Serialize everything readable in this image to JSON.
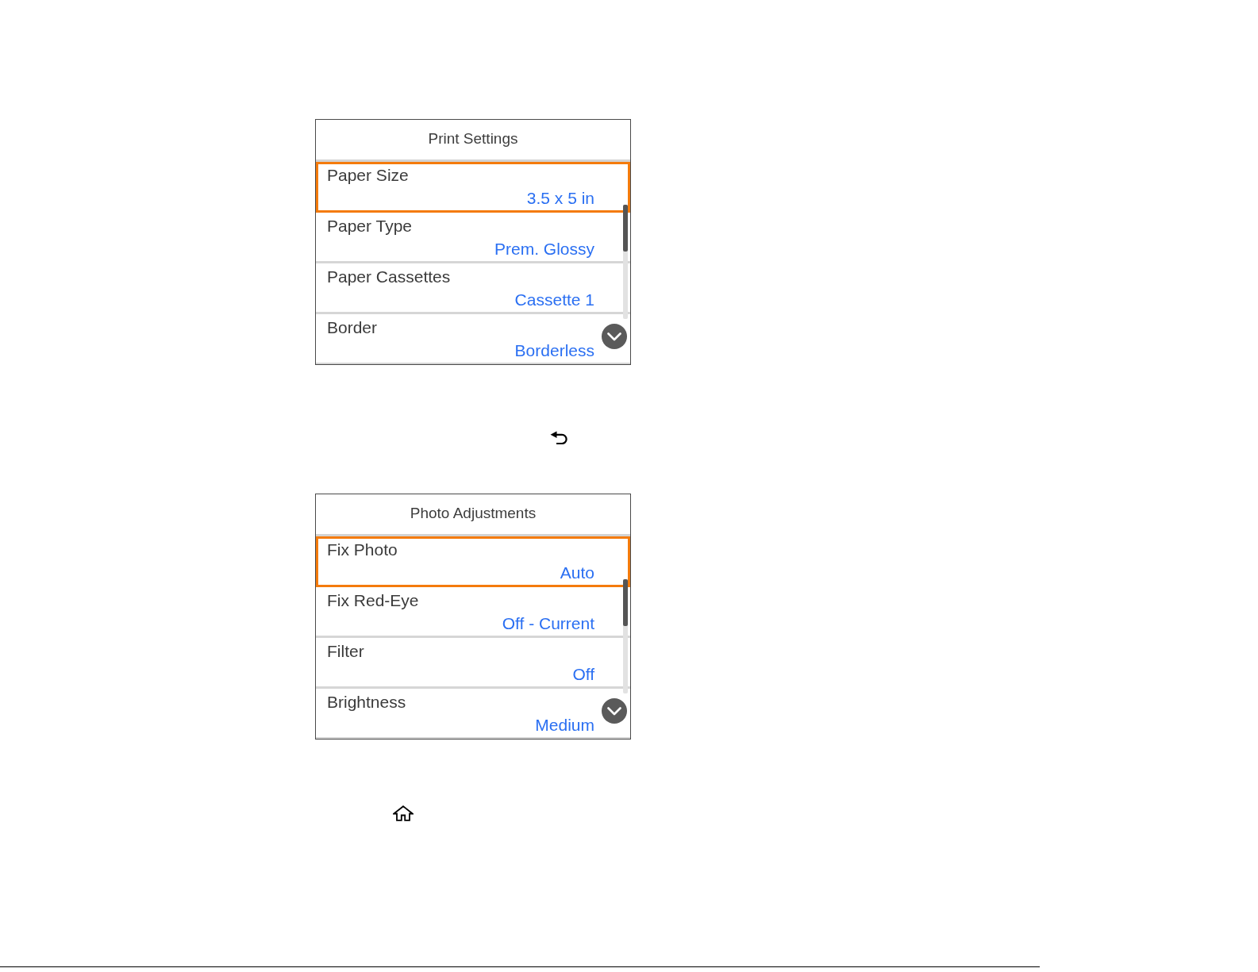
{
  "screens": [
    {
      "title": "Print Settings",
      "items": [
        {
          "label": "Paper Size",
          "value": "3.5 x 5 in",
          "selected": true
        },
        {
          "label": "Paper Type",
          "value": "Prem. Glossy",
          "selected": false
        },
        {
          "label": "Paper Cassettes",
          "value": "Cassette 1",
          "selected": false
        },
        {
          "label": "Border",
          "value": "Borderless",
          "selected": false
        }
      ]
    },
    {
      "title": "Photo Adjustments",
      "items": [
        {
          "label": "Fix Photo",
          "value": "Auto",
          "selected": true
        },
        {
          "label": "Fix Red-Eye",
          "value": "Off - Current",
          "selected": false
        },
        {
          "label": "Filter",
          "value": "Off",
          "selected": false
        },
        {
          "label": "Brightness",
          "value": "Medium",
          "selected": false
        }
      ]
    }
  ]
}
